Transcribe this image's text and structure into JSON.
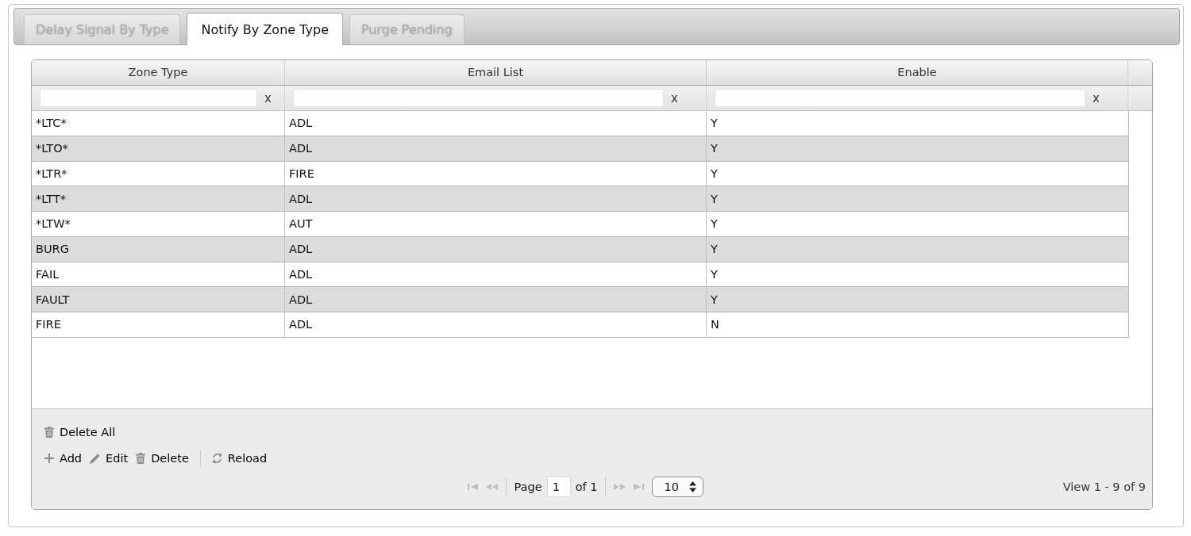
{
  "tabs": [
    {
      "label": "Delay Signal By Type",
      "selected": false,
      "disabled": true
    },
    {
      "label": "Notify By Zone Type",
      "selected": true,
      "disabled": false
    },
    {
      "label": "Purge Pending",
      "selected": false,
      "disabled": true
    }
  ],
  "grid": {
    "columns": [
      {
        "label": "Zone Type"
      },
      {
        "label": "Email List"
      },
      {
        "label": "Enable"
      }
    ],
    "filters": [
      {
        "clear": "x"
      },
      {
        "clear": "x"
      },
      {
        "clear": "x"
      }
    ],
    "rows": [
      [
        "*LTC*",
        "ADL",
        "Y"
      ],
      [
        "*LTO*",
        "ADL",
        "Y"
      ],
      [
        "*LTR*",
        "FIRE",
        "Y"
      ],
      [
        "*LTT*",
        "ADL",
        "Y"
      ],
      [
        "*LTW*",
        "AUT",
        "Y"
      ],
      [
        "BURG",
        "ADL",
        "Y"
      ],
      [
        "FAIL",
        "ADL",
        "Y"
      ],
      [
        "FAULT",
        "ADL",
        "Y"
      ],
      [
        "FIRE",
        "ADL",
        "N"
      ]
    ],
    "actions": [
      [
        {
          "kind": "delete_all",
          "label": "Delete All"
        }
      ],
      [
        {
          "kind": "add",
          "label": "Add"
        },
        {
          "kind": "edit",
          "label": "Edit"
        },
        {
          "kind": "delete",
          "label": "Delete"
        },
        {
          "kind": "separator"
        },
        {
          "kind": "reload",
          "label": "Reload"
        }
      ]
    ],
    "pager": {
      "items": [
        {
          "kind": "first",
          "disabled": true
        },
        {
          "kind": "prev",
          "disabled": true
        },
        {
          "kind": "separator"
        },
        {
          "kind": "page",
          "label": "Page",
          "value": "1",
          "total": "of 1"
        },
        {
          "kind": "separator"
        },
        {
          "kind": "next",
          "disabled": true
        },
        {
          "kind": "last",
          "disabled": true
        },
        {
          "kind": "page_size",
          "value": "10"
        }
      ],
      "record_info": "View 1 - 9 of 9"
    }
  }
}
